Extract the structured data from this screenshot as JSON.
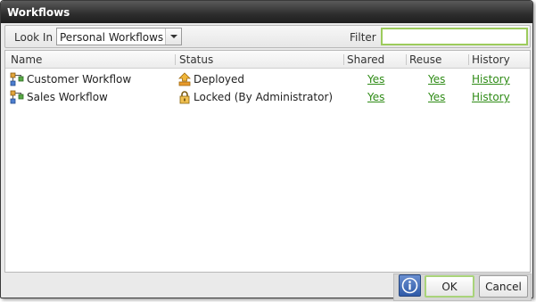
{
  "dialog": {
    "title": "Workflows"
  },
  "toolbar": {
    "look_in_label": "Look In",
    "look_in_value": "Personal Workflows",
    "filter_label": "Filter",
    "filter_value": ""
  },
  "grid": {
    "columns": [
      "Name",
      "Status",
      "Shared",
      "Reuse",
      "History"
    ],
    "rows": [
      {
        "name": "Customer Workflow",
        "status": "Deployed",
        "status_icon": "deployed-icon",
        "shared": "Yes",
        "reuse": "Yes",
        "history": "History"
      },
      {
        "name": "Sales Workflow",
        "status": "Locked (By Administrator)",
        "status_icon": "lock-icon",
        "shared": "Yes",
        "reuse": "Yes",
        "history": "History"
      }
    ]
  },
  "buttons": {
    "ok": "OK",
    "cancel": "Cancel",
    "info_icon": "info-icon"
  },
  "colors": {
    "link": "#2e8b15",
    "accent_focus": "#9ccb5c",
    "titlebar": "#2d2d2d"
  }
}
